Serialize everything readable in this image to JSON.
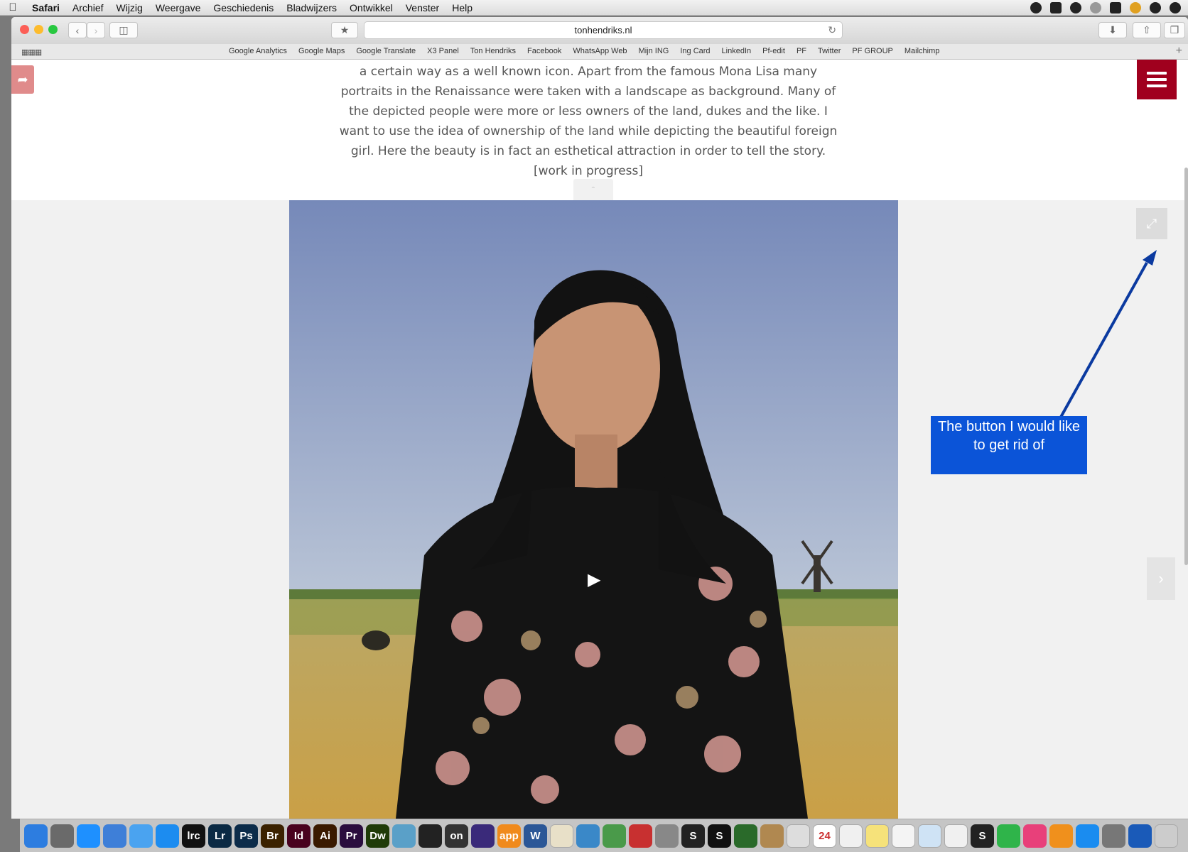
{
  "menubar": {
    "items": [
      "Safari",
      "Archief",
      "Wijzig",
      "Weergave",
      "Geschiedenis",
      "Bladwijzers",
      "Ontwikkel",
      "Venster",
      "Help"
    ]
  },
  "browser": {
    "url": "tonhendriks.nl",
    "bookmarks": [
      "Google Analytics",
      "Google Maps",
      "Google Translate",
      "X3 Panel",
      "Ton Hendriks",
      "Facebook",
      "WhatsApp Web",
      "Mijn ING",
      "Ing Card",
      "LinkedIn",
      "Pf-edit",
      "PF",
      "Twitter",
      "PF GROUP",
      "Mailchimp"
    ]
  },
  "page": {
    "description": "a certain way as a well known icon. Apart from the famous Mona Lisa many portraits in the Renaissance were taken with a landscape as background. Many of the depicted people were more or less owners of the land, dukes and the like. I want to use the idea of ownership of the land while depicting the beautiful foreign girl. Here the beauty is in fact an esthetical attraction in order to tell the story. [work in progress]"
  },
  "annotation": {
    "text": "The button I would like to get rid of",
    "color": "#0b54d8"
  },
  "dock": {
    "items": [
      {
        "label": "",
        "color": "#2d7de0",
        "icon": "finder-icon"
      },
      {
        "label": "",
        "color": "#6a6a6a",
        "icon": "launchpad-icon"
      },
      {
        "label": "",
        "color": "#1e90ff",
        "icon": "messages-icon"
      },
      {
        "label": "",
        "color": "#3e7fd8",
        "icon": "mail-icon"
      },
      {
        "label": "",
        "color": "#4aa3f0",
        "icon": "chat-icon"
      },
      {
        "label": "",
        "color": "#1c8cf0",
        "icon": "safari-icon"
      },
      {
        "label": "lrc",
        "color": "#111111",
        "icon": "lightroom-classic-icon"
      },
      {
        "label": "Lr",
        "color": "#0b2a44",
        "icon": "lightroom-icon"
      },
      {
        "label": "Ps",
        "color": "#0c2c4a",
        "icon": "photoshop-icon"
      },
      {
        "label": "Br",
        "color": "#3b2200",
        "icon": "bridge-icon"
      },
      {
        "label": "Id",
        "color": "#49021f",
        "icon": "indesign-icon"
      },
      {
        "label": "Ai",
        "color": "#3a1a00",
        "icon": "illustrator-icon"
      },
      {
        "label": "Pr",
        "color": "#2a0d3e",
        "icon": "premiere-icon"
      },
      {
        "label": "Dw",
        "color": "#1f3b08",
        "icon": "dreamweaver-icon"
      },
      {
        "label": "",
        "color": "#5aa0c8",
        "icon": "globe-icon"
      },
      {
        "label": "",
        "color": "#222222",
        "icon": "dial-icon"
      },
      {
        "label": "on",
        "color": "#333333",
        "icon": "on1-icon"
      },
      {
        "label": "",
        "color": "#3a2a7a",
        "icon": "vpn-icon"
      },
      {
        "label": "app",
        "color": "#f08a1c",
        "icon": "appcleaner-icon"
      },
      {
        "label": "W",
        "color": "#2b5797",
        "icon": "word-icon"
      },
      {
        "label": "",
        "color": "#e8e0c8",
        "icon": "notes-icon"
      },
      {
        "label": "",
        "color": "#3a88c8",
        "icon": "preview-icon"
      },
      {
        "label": "",
        "color": "#4a9a4a",
        "icon": "numbers-icon"
      },
      {
        "label": "",
        "color": "#c83030",
        "icon": "binder-icon"
      },
      {
        "label": "",
        "color": "#888888",
        "icon": "calculator-icon"
      },
      {
        "label": "S",
        "color": "#222222",
        "icon": "scrivener-icon"
      },
      {
        "label": "S",
        "color": "#111111",
        "icon": "s-app-icon"
      },
      {
        "label": "",
        "color": "#2a6a2a",
        "icon": "colorchecker-icon"
      },
      {
        "label": "",
        "color": "#b08850",
        "icon": "contacts-icon"
      },
      {
        "label": "",
        "color": "#dddddd",
        "icon": "clock-icon"
      },
      {
        "label": "24",
        "color": "#ffffff",
        "icon": "calendar-icon"
      },
      {
        "label": "",
        "color": "#f0f0f0",
        "icon": "textedit-icon"
      },
      {
        "label": "",
        "color": "#f6e27a",
        "icon": "stickies-icon"
      },
      {
        "label": "",
        "color": "#f4f4f4",
        "icon": "reminders-icon"
      },
      {
        "label": "",
        "color": "#cfe3f5",
        "icon": "maps-icon"
      },
      {
        "label": "",
        "color": "#f0f0f0",
        "icon": "photos-icon"
      },
      {
        "label": "S",
        "color": "#222222",
        "icon": "skype-icon"
      },
      {
        "label": "",
        "color": "#2fb44a",
        "icon": "facetime-icon"
      },
      {
        "label": "",
        "color": "#e8407a",
        "icon": "itunes-icon"
      },
      {
        "label": "",
        "color": "#f0901c",
        "icon": "ibooks-icon"
      },
      {
        "label": "",
        "color": "#1a8cf0",
        "icon": "appstore-icon"
      },
      {
        "label": "",
        "color": "#777777",
        "icon": "system-preferences-icon"
      },
      {
        "label": "",
        "color": "#1a5ab8",
        "icon": "1password-icon"
      },
      {
        "label": "",
        "color": "#cccccc",
        "icon": "trash-icon"
      }
    ]
  }
}
